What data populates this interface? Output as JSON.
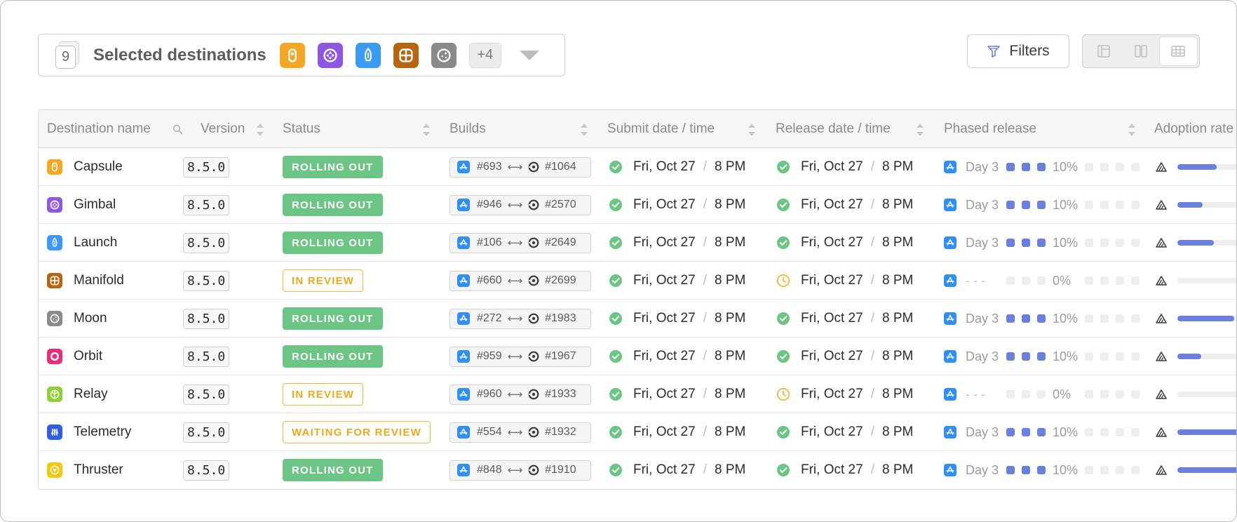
{
  "colors": {
    "accent": "#6b7fde",
    "rolling_out": "#6cc485",
    "in_review": "#f0a81a",
    "app_store_blue": "#2f8ff5",
    "check_green": "#6cc485",
    "clock_amber": "#f3b53a"
  },
  "header": {
    "selected_count": "9",
    "selected_title": "Selected destinations",
    "selected_icons": [
      {
        "name": "capsule-app-icon",
        "color": "#f5a623"
      },
      {
        "name": "gimbal-app-icon",
        "color": "#8e57e3"
      },
      {
        "name": "launch-app-icon",
        "color": "#3a9bf4"
      },
      {
        "name": "manifold-app-icon",
        "color": "#b8650f"
      },
      {
        "name": "moon-app-icon",
        "color": "#8a8a8a"
      }
    ],
    "more_label": "+4",
    "filters_label": "Filters",
    "view_modes": [
      "sidebar-view-icon",
      "split-view-icon",
      "table-view-icon"
    ],
    "active_view": "table-view-icon"
  },
  "columns": {
    "name": "Destination name",
    "version": "Version",
    "status": "Status",
    "builds": "Builds",
    "submit": "Submit date / time",
    "release": "Release date / time",
    "phased": "Phased release",
    "adoption": "Adoption rate"
  },
  "rows": [
    {
      "name": "Capsule",
      "icon_color": "#f5a623",
      "version": "8.5.0",
      "status": "ROLLING OUT",
      "status_kind": "rolling",
      "build_store": "#693",
      "build_ci": "#1064",
      "submit_date": "Fri, Oct 27",
      "submit_time": "8 PM",
      "release_state": "done",
      "release_date": "Fri, Oct 27",
      "release_time": "8 PM",
      "phase_day": "Day 3",
      "phase_steps_on": 3,
      "phase_pct": "10%",
      "adoption": 0.62
    },
    {
      "name": "Gimbal",
      "icon_color": "#8e57e3",
      "version": "8.5.0",
      "status": "ROLLING OUT",
      "status_kind": "rolling",
      "build_store": "#946",
      "build_ci": "#2570",
      "submit_date": "Fri, Oct 27",
      "submit_time": "8 PM",
      "release_state": "done",
      "release_date": "Fri, Oct 27",
      "release_time": "8 PM",
      "phase_day": "Day 3",
      "phase_steps_on": 3,
      "phase_pct": "10%",
      "adoption": 0.4
    },
    {
      "name": "Launch",
      "icon_color": "#3a9bf4",
      "version": "8.5.0",
      "status": "ROLLING OUT",
      "status_kind": "rolling",
      "build_store": "#106",
      "build_ci": "#2649",
      "submit_date": "Fri, Oct 27",
      "submit_time": "8 PM",
      "release_state": "done",
      "release_date": "Fri, Oct 27",
      "release_time": "8 PM",
      "phase_day": "Day 3",
      "phase_steps_on": 3,
      "phase_pct": "10%",
      "adoption": 0.58
    },
    {
      "name": "Manifold",
      "icon_color": "#b8650f",
      "version": "8.5.0",
      "status": "IN REVIEW",
      "status_kind": "review",
      "build_store": "#660",
      "build_ci": "#2699",
      "submit_date": "Fri, Oct 27",
      "submit_time": "8 PM",
      "release_state": "pending",
      "release_date": "Fri, Oct 27",
      "release_time": "8 PM",
      "phase_day": "- - -",
      "phase_steps_on": 0,
      "phase_pct": "0%",
      "adoption": 0
    },
    {
      "name": "Moon",
      "icon_color": "#8a8a8a",
      "version": "8.5.0",
      "status": "ROLLING OUT",
      "status_kind": "rolling",
      "build_store": "#272",
      "build_ci": "#1983",
      "submit_date": "Fri, Oct 27",
      "submit_time": "8 PM",
      "release_state": "done",
      "release_date": "Fri, Oct 27",
      "release_time": "8 PM",
      "phase_day": "Day 3",
      "phase_steps_on": 3,
      "phase_pct": "10%",
      "adoption": 0.9
    },
    {
      "name": "Orbit",
      "icon_color": "#e8307a",
      "version": "8.5.0",
      "status": "ROLLING OUT",
      "status_kind": "rolling",
      "build_store": "#959",
      "build_ci": "#1967",
      "submit_date": "Fri, Oct 27",
      "submit_time": "8 PM",
      "release_state": "done",
      "release_date": "Fri, Oct 27",
      "release_time": "8 PM",
      "phase_day": "Day 3",
      "phase_steps_on": 3,
      "phase_pct": "10%",
      "adoption": 0.38
    },
    {
      "name": "Relay",
      "icon_color": "#8fcf3a",
      "version": "8.5.0",
      "status": "IN REVIEW",
      "status_kind": "review",
      "build_store": "#960",
      "build_ci": "#1933",
      "submit_date": "Fri, Oct 27",
      "submit_time": "8 PM",
      "release_state": "pending",
      "release_date": "Fri, Oct 27",
      "release_time": "8 PM",
      "phase_day": "- - -",
      "phase_steps_on": 0,
      "phase_pct": "0%",
      "adoption": 0
    },
    {
      "name": "Telemetry",
      "icon_color": "#2f5fe0",
      "version": "8.5.0",
      "status": "WAITING FOR REVIEW",
      "status_kind": "review",
      "build_store": "#554",
      "build_ci": "#1932",
      "submit_date": "Fri, Oct 27",
      "submit_time": "8 PM",
      "release_state": "done",
      "release_date": "Fri, Oct 27",
      "release_time": "8 PM",
      "phase_day": "Day 3",
      "phase_steps_on": 3,
      "phase_pct": "10%",
      "adoption": 1.0
    },
    {
      "name": "Thruster",
      "icon_color": "#f2c811",
      "version": "8.5.0",
      "status": "ROLLING OUT",
      "status_kind": "rolling",
      "build_store": "#848",
      "build_ci": "#1910",
      "submit_date": "Fri, Oct 27",
      "submit_time": "8 PM",
      "release_state": "done",
      "release_date": "Fri, Oct 27",
      "release_time": "8 PM",
      "phase_day": "Day 3",
      "phase_steps_on": 3,
      "phase_pct": "10%",
      "adoption": 1.0
    }
  ]
}
